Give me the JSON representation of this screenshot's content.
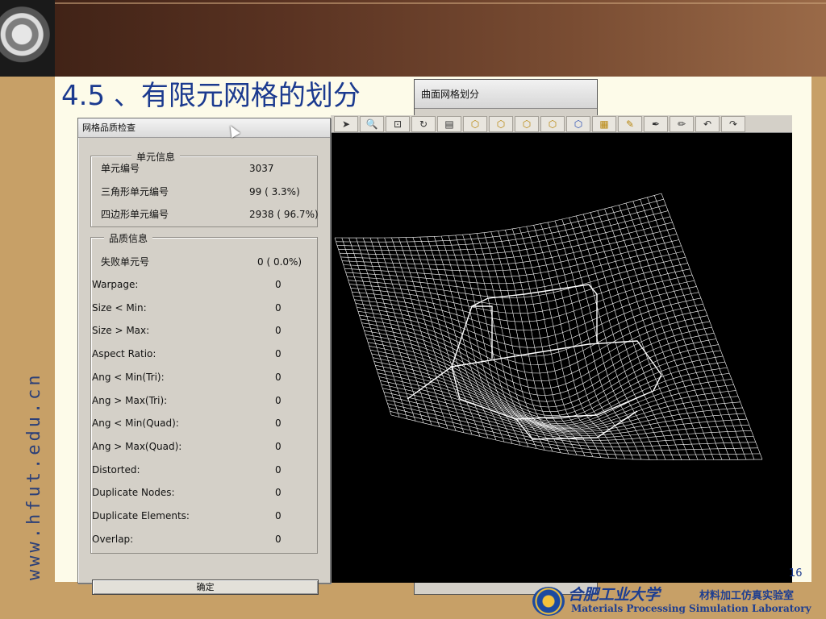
{
  "slide": {
    "title": "4.5 、有限元网格的划分",
    "side_url": "www.hfut.edu.cn",
    "page_number": "16",
    "university_name": "合肥工业大学",
    "lab_name_cn": "材料加工仿真实验室",
    "lab_name_en": "Materials Processing Simulation Laboratory"
  },
  "mesh_dialog": {
    "title": "曲面网格划分"
  },
  "toolbar": {
    "icons": [
      "pointer-icon",
      "zoom-icon",
      "fit-icon",
      "rotate-icon",
      "view-icon",
      "cube-front-icon",
      "cube-top-icon",
      "cube-side-icon",
      "cube-iso-icon",
      "cube-blue-icon",
      "mesh-grid-icon",
      "mesh-brush-icon",
      "pen-icon",
      "pencil-icon",
      "undo-icon",
      "redo-icon"
    ]
  },
  "quality_dialog": {
    "title": "网格品质检查",
    "element_info": {
      "legend": "单元信息",
      "rows": [
        {
          "label": "单元编号",
          "value": "3037"
        },
        {
          "label": "三角形单元编号",
          "value": "99 ( 3.3%)"
        },
        {
          "label": "四边形单元编号",
          "value": "2938 ( 96.7%)"
        }
      ]
    },
    "quality_info": {
      "legend": "品质信息",
      "failed": {
        "label": "失败单元号",
        "value": "0 ( 0.0%)"
      },
      "rows": [
        {
          "label": "Warpage:",
          "value": "0"
        },
        {
          "label": "Size < Min:",
          "value": "0"
        },
        {
          "label": "Size > Max:",
          "value": "0"
        },
        {
          "label": "Aspect Ratio:",
          "value": "0"
        },
        {
          "label": "Ang < Min(Tri):",
          "value": "0"
        },
        {
          "label": "Ang > Max(Tri):",
          "value": "0"
        },
        {
          "label": "Ang < Min(Quad):",
          "value": "0"
        },
        {
          "label": "Ang > Max(Quad):",
          "value": "0"
        },
        {
          "label": "Distorted:",
          "value": "0"
        },
        {
          "label": "Duplicate Nodes:",
          "value": "0"
        },
        {
          "label": "Duplicate Elements:",
          "value": "0"
        },
        {
          "label": "Overlap:",
          "value": "0"
        }
      ]
    },
    "ok_label": "确定"
  },
  "colors": {
    "title": "#1b3a8f",
    "frame": "#c7a067",
    "mesh": "#ffffff",
    "viewport": "#000000"
  }
}
